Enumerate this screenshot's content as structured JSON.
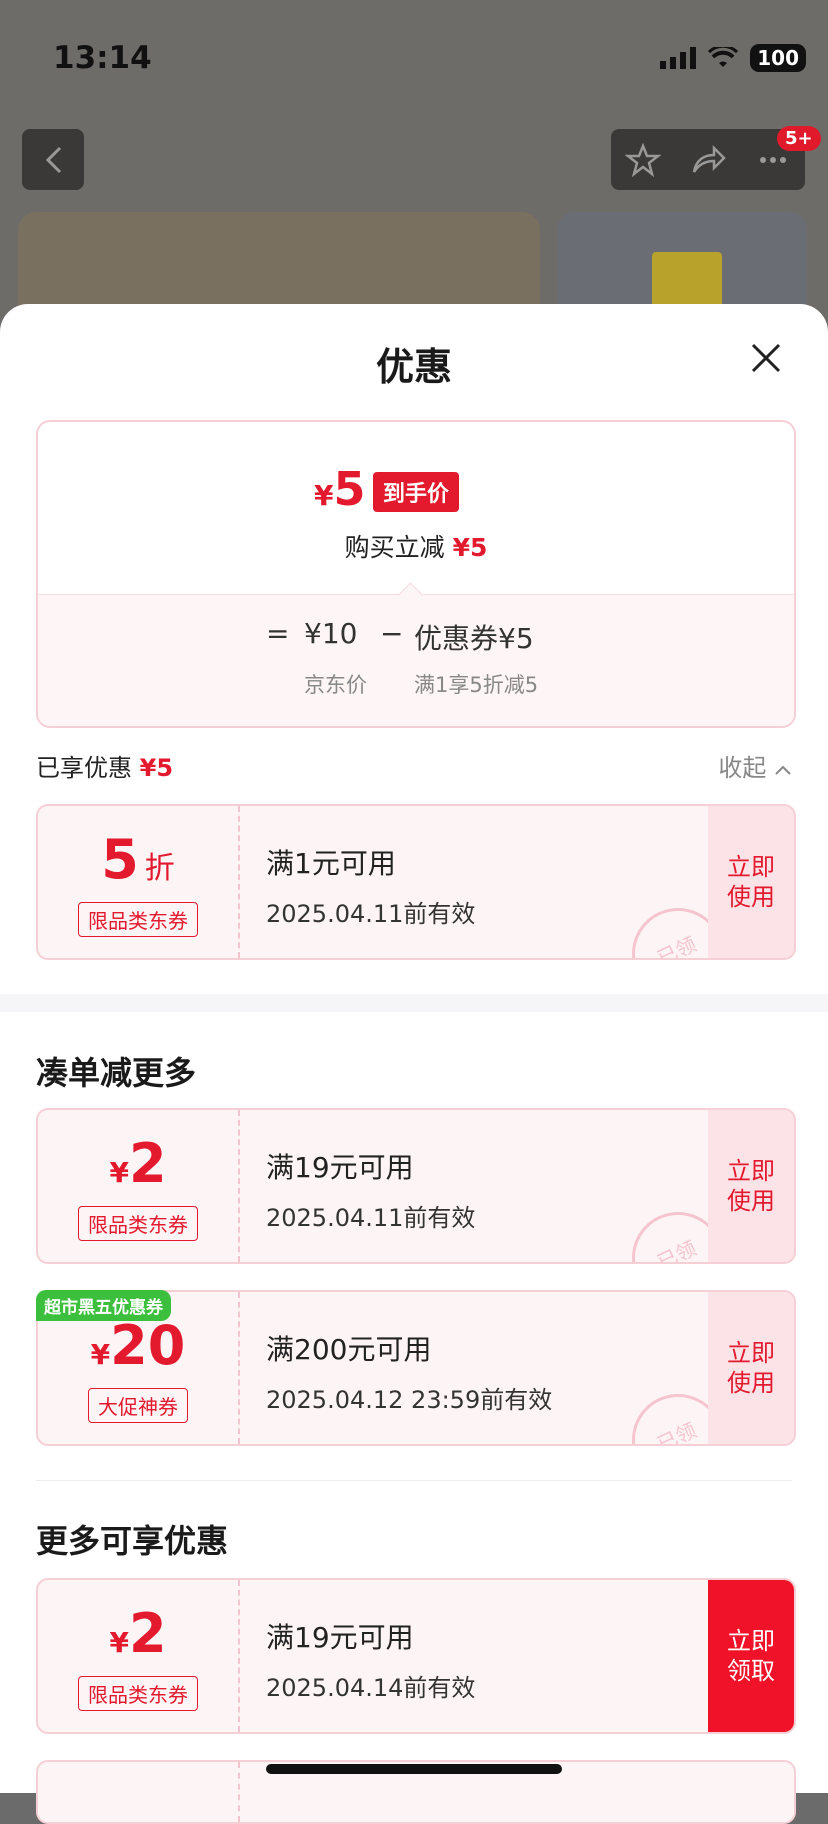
{
  "status_bar": {
    "time": "13:14",
    "battery": "100"
  },
  "header": {
    "badge": "5+"
  },
  "sheet": {
    "title": "优惠",
    "price_summary": {
      "currency": "¥",
      "final_price": "5",
      "final_label": "到手价",
      "reduce_text": "购买立减",
      "reduce_amount": "¥5",
      "equals": "=",
      "jd_price": "¥10",
      "jd_price_label": "京东价",
      "minus": "−",
      "coupon_text": "优惠券¥5",
      "coupon_desc": "满1享5折减5"
    },
    "enjoyed": {
      "label": "已享优惠",
      "amount": "¥5",
      "collapse": "收起"
    },
    "enjoyed_coupon": {
      "amount": "5",
      "unit": "折",
      "tag": "限品类东券",
      "condition": "满1元可用",
      "expiry": "2025.04.11前有效",
      "action": "立即\n使用",
      "stamp": "已领"
    },
    "section_more": {
      "title": "凑单减更多",
      "coupons": [
        {
          "currency": "¥",
          "amount": "2",
          "tag": "限品类东券",
          "condition": "满19元可用",
          "expiry": "2025.04.11前有效",
          "action_1": "立即",
          "action_2": "使用",
          "stamp": "已领"
        },
        {
          "badge": "超市黑五优惠券",
          "currency": "¥",
          "amount": "20",
          "tag": "大促神券",
          "condition": "满200元可用",
          "expiry": "2025.04.12 23:59前有效",
          "action_1": "立即",
          "action_2": "使用",
          "stamp": "已领"
        }
      ]
    },
    "section_available": {
      "title": "更多可享优惠",
      "coupons": [
        {
          "currency": "¥",
          "amount": "2",
          "tag": "限品类东券",
          "condition": "满19元可用",
          "expiry": "2025.04.14前有效",
          "action_1": "立即",
          "action_2": "领取"
        }
      ]
    }
  },
  "colors": {
    "accent_red": "#e3192d",
    "coupon_bg": "#fdf4f6",
    "promo_green": "#3bbf3c"
  }
}
